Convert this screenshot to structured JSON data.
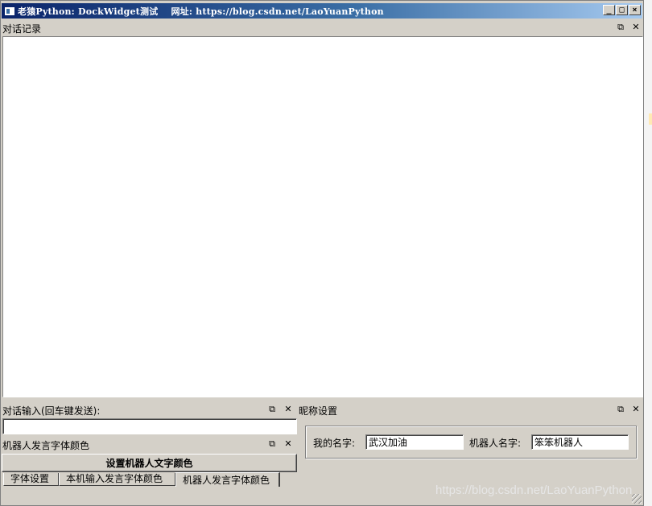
{
  "window": {
    "title": "老猿Python: DockWidget测试    网址: https://blog.csdn.net/LaoYuanPython",
    "minimize_glyph": "_",
    "maximize_glyph": "□",
    "close_glyph": "×"
  },
  "dock_controls": {
    "float_glyph": "⧉",
    "close_glyph": "✕"
  },
  "chat_dock": {
    "title": "对话记录"
  },
  "input_dock": {
    "title": "对话输入(回车键发送):",
    "value": ""
  },
  "robot_color_dock": {
    "title": "机器人发言字体颜色",
    "button_label": "设置机器人文字颜色"
  },
  "nickname_dock": {
    "title": "昵称设置",
    "my_name_label": "我的名字:",
    "my_name_value": "武汉加油",
    "robot_name_label": "机器人名字:",
    "robot_name_value": "笨笨机器人"
  },
  "tabs": [
    {
      "label": "字体设置",
      "active": false
    },
    {
      "label": "本机输入发言字体颜色",
      "active": false
    },
    {
      "label": "机器人发言字体颜色",
      "active": true
    }
  ],
  "watermark": "https://blog.csdn.net/LaoYuanPython",
  "colors": {
    "title_start": "#0a246a",
    "title_end": "#a6caf0",
    "face": "#d4d0c8"
  }
}
